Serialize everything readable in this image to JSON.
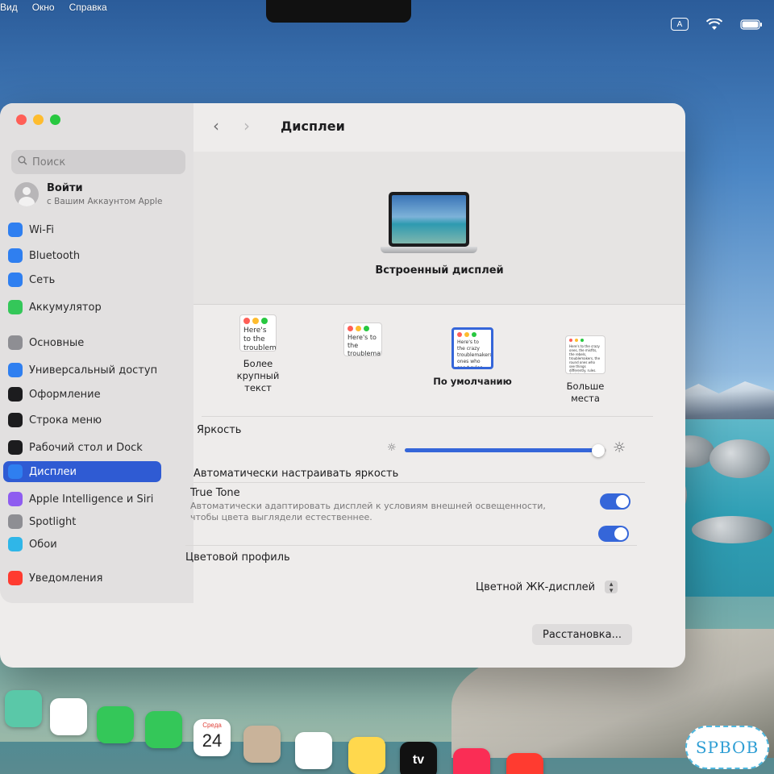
{
  "menubar": {
    "items": [
      "Вид",
      "Окно",
      "Справка"
    ]
  },
  "status": {
    "input_source": "A",
    "icons": [
      "keyboard-input-icon",
      "wifi-icon",
      "battery-icon"
    ]
  },
  "window": {
    "traffic_lights": [
      "close",
      "minimize",
      "zoom"
    ],
    "colors": {
      "accent": "#3566d9",
      "sidebar_selection": "#2f5bd3"
    }
  },
  "sidebar": {
    "search_placeholder": "Поиск",
    "account": {
      "title": "Войти",
      "subtitle": "с Вашим Аккаунтом Apple"
    },
    "items": [
      {
        "label": "Wi-Fi",
        "icon": "wifi-icon",
        "color": "#2f7ff0"
      },
      {
        "label": "Bluetooth",
        "icon": "bluetooth-icon",
        "color": "#2f7ff0"
      },
      {
        "label": "Сеть",
        "icon": "network-globe-icon",
        "color": "#2f7ff0"
      },
      {
        "label": "Аккумулятор",
        "icon": "battery-icon",
        "color": "#34c759"
      },
      {
        "label": "Основные",
        "icon": "gear-icon",
        "color": "#8e8e93"
      },
      {
        "label": "Универсальный доступ",
        "icon": "accessibility-icon",
        "color": "#2f7ff0"
      },
      {
        "label": "Оформление",
        "icon": "appearance-icon",
        "color": "#1c1c1e"
      },
      {
        "label": "Строка меню",
        "icon": "menubar-icon",
        "color": "#1c1c1e"
      },
      {
        "label": "Рабочий стол и Dock",
        "icon": "desktop-dock-icon",
        "color": "#1c1c1e"
      },
      {
        "label": "Дисплеи",
        "icon": "display-icon",
        "color": "#2f7ff0",
        "selected": true
      },
      {
        "label": "Apple Intelligence и Siri",
        "icon": "siri-icon",
        "color": "#8e5cf0"
      },
      {
        "label": "Spotlight",
        "icon": "spotlight-icon",
        "color": "#8e8e93"
      },
      {
        "label": "Обои",
        "icon": "wallpaper-icon",
        "color": "#2fb6e8"
      },
      {
        "label": "Уведомления",
        "icon": "notifications-icon",
        "color": "#ff3b30"
      }
    ]
  },
  "main": {
    "title": "Дисплеи",
    "display_name": "Встроенный дисплей",
    "resolution_options": [
      {
        "label": "Более крупный текст",
        "preview": "Here's to the troublemakers",
        "selected": false
      },
      {
        "label": "",
        "preview": "Here's to the troublemakers, ones who",
        "selected": false
      },
      {
        "label": "По умолчанию",
        "preview": "Here's to the crazy troublemakers, ones who see t rules. And the",
        "selected": true
      },
      {
        "label": "Больше места",
        "preview": "Here's to the crazy ones, the misfits, the rebels, troublemakers, the round ones who see things differently. rules. And they have no respect. You can quote them, disagree with them. Because they change things.",
        "selected": false
      }
    ],
    "brightness": {
      "label": "Яркость",
      "level": 0.96
    },
    "auto_brightness": {
      "label": "Автоматически настраивать яркость",
      "on": true
    },
    "true_tone": {
      "label": "True Tone",
      "description": "Автоматически адаптировать дисплей к условиям внешней освещенности, чтобы цвета выглядели естественнее.",
      "on": true
    },
    "color_profile": {
      "label": "Цветовой профиль",
      "value": "Цветной ЖК-дисплей"
    },
    "arrange_button": "Расстановка..."
  },
  "dock": {
    "apps": [
      {
        "name": "maps-app-icon",
        "color": "#5ac8a8"
      },
      {
        "name": "photos-app-icon",
        "color": "#ffffff"
      },
      {
        "name": "facetime-app-icon",
        "color": "#34c759"
      },
      {
        "name": "phone-app-icon",
        "color": "#34c759"
      },
      {
        "name": "calendar-app-icon",
        "color": "#ffffff",
        "day": "Среда",
        "date": "24"
      },
      {
        "name": "contacts-app-icon",
        "color": "#c9b39a"
      },
      {
        "name": "reminders-app-icon",
        "color": "#ffffff"
      },
      {
        "name": "notes-app-icon",
        "color": "#ffd84d"
      },
      {
        "name": "tv-app-icon",
        "color": "#111111",
        "label": "tv"
      },
      {
        "name": "music-app-icon",
        "color": "#fa2d55"
      },
      {
        "name": "news-app-icon",
        "color": "#ff3b30"
      }
    ]
  },
  "watermark": {
    "text": "SPBOB"
  }
}
